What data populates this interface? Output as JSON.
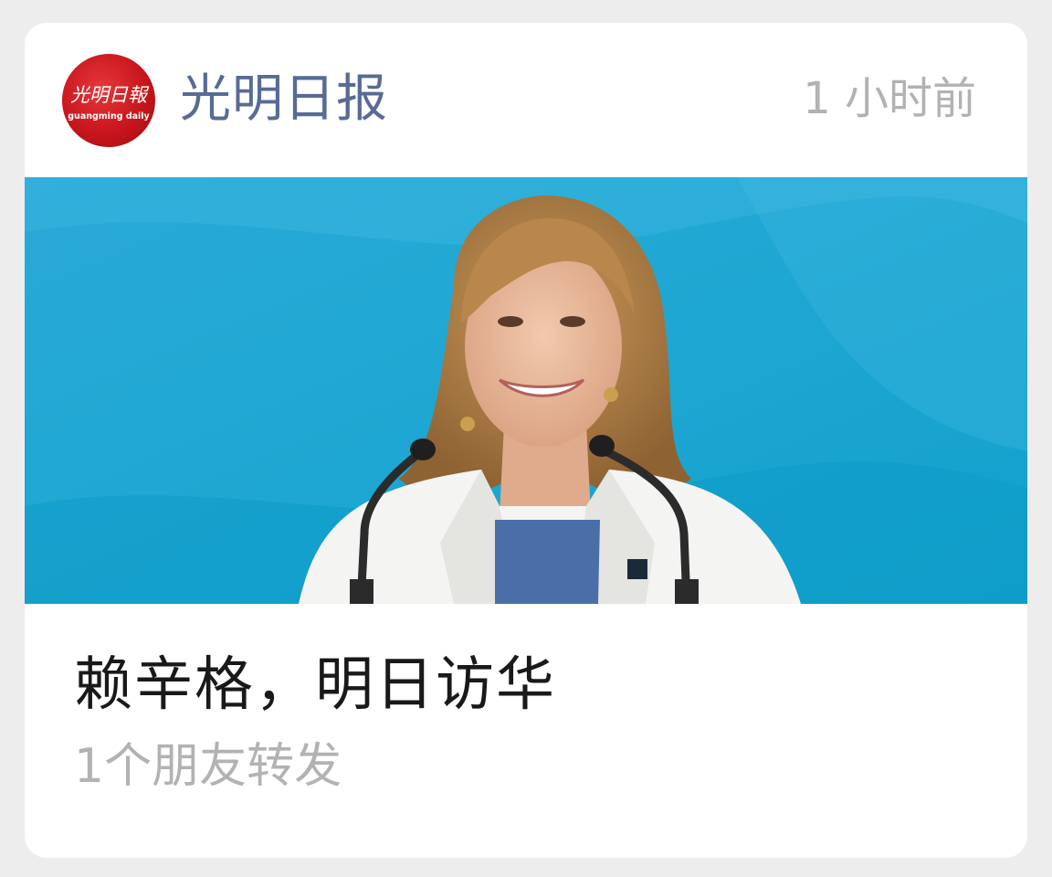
{
  "article_card": {
    "source": {
      "name": "光明日报",
      "logo_text_cn": "光明日報",
      "logo_text_en": "guangming daily",
      "logo_color": "#c8161c"
    },
    "time": "1 小时前",
    "cover_image": {
      "description_icon": "photo-icon",
      "background_color": "#1ea7d2"
    },
    "headline": "赖辛格，明日访华",
    "share_count": "1个朋友转发"
  },
  "colors": {
    "source_name": "#576b95",
    "secondary_text": "#b2b2b2",
    "headline_text": "#191919",
    "page_background": "#ededed",
    "card_background": "#ffffff"
  }
}
